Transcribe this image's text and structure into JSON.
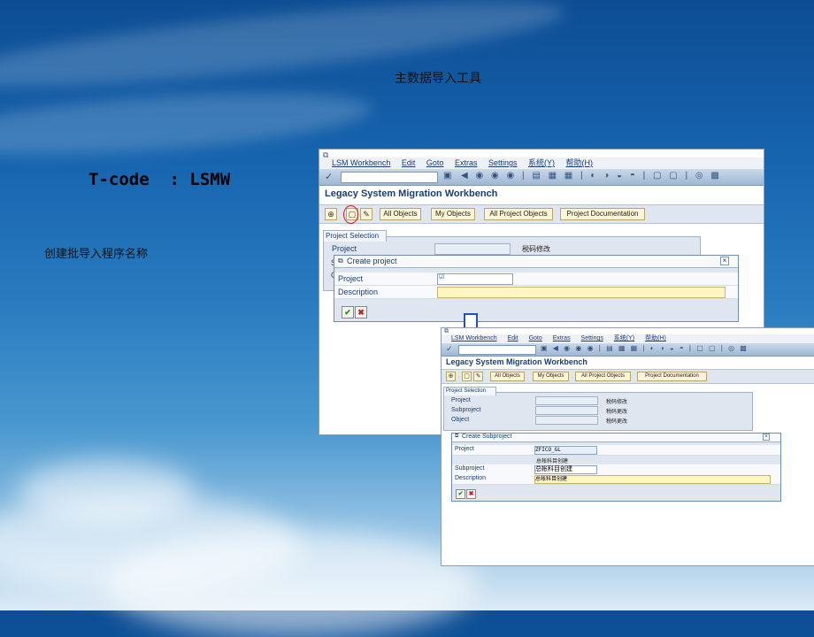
{
  "slide": {
    "title": "主数据导入工具",
    "tcode": "T-code  : LSMW",
    "note": "创建批导入程序名称"
  },
  "sap_top": {
    "menu": [
      "LSM Workbench",
      "Edit",
      "Goto",
      "Extras",
      "Settings",
      "系统(Y)",
      "帮助(H)"
    ],
    "title": "Legacy System Migration Workbench",
    "buttons": [
      "All Objects",
      "My Objects",
      "All Project Objects",
      "Project Documentation"
    ],
    "group_tab": "Project Selection",
    "project_label": "Project",
    "project_hint": "税码修改",
    "dialog": {
      "title": "Create project",
      "project_label": "Project",
      "project_value": "",
      "description_label": "Description",
      "description_value": ""
    }
  },
  "sap_bottom": {
    "menu": [
      "LSM Workbench",
      "Edit",
      "Goto",
      "Extras",
      "Settings",
      "系统(Y)",
      "帮助(H)"
    ],
    "title": "Legacy System Migration Workbench",
    "buttons": [
      "All Objects",
      "My Objects",
      "All Project Objects",
      "Project Documentation"
    ],
    "group_tab": "Project Selection",
    "rows": [
      {
        "label": "Project",
        "hint": "税码修改"
      },
      {
        "label": "Subproject",
        "hint": "税码更改"
      },
      {
        "label": "Object",
        "hint": "税码更改"
      }
    ],
    "dialog": {
      "title": "Create Subproject",
      "project_label": "Project",
      "project_value": "ZFICO_GL",
      "project_desc": "总帐科目创建",
      "subproject_label": "Subproject",
      "subproject_value": "总帐科目创建",
      "description_label": "Description",
      "description_value": "总帐科目创建"
    }
  },
  "colors": {
    "arrow": "#1f4fd8",
    "highlight_circle": "#d21f1f"
  }
}
